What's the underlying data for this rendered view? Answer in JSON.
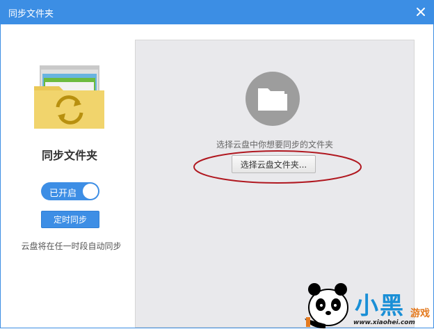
{
  "window": {
    "title": "同步文件夹"
  },
  "left": {
    "heading": "同步文件夹",
    "toggle_label": "已开启",
    "timed_sync_label": "定时同步",
    "auto_sync_text": "云盘将在任一时段自动同步"
  },
  "right": {
    "prompt": "选择云盘中你想要同步的文件夹",
    "select_button_label": "选择云盘文件夹..."
  },
  "watermark": {
    "big_text": "小黑",
    "small_text": "游戏",
    "url": "www.xiaohei.com"
  },
  "colors": {
    "titlebar": "#3c8ee4",
    "accent": "#3d8ee5",
    "annotation": "#b0171f"
  }
}
